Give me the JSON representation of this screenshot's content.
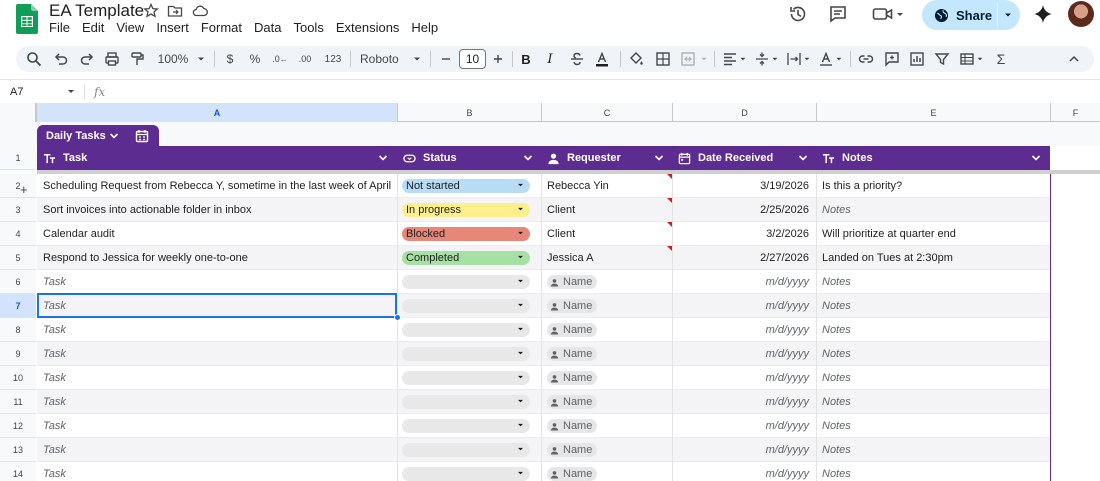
{
  "app": {
    "title": "EA Template",
    "menus": [
      "File",
      "Edit",
      "View",
      "Insert",
      "Format",
      "Data",
      "Tools",
      "Extensions",
      "Help"
    ],
    "share_label": "Share",
    "brand_color": "#5c2c91",
    "accent_color": "#1a73e8"
  },
  "toolbar": {
    "zoom": "100%",
    "currency": "$",
    "percent": "%",
    "number_format": "123",
    "font": "Roboto",
    "font_size": "10"
  },
  "formula_bar": {
    "cell_ref": "A7",
    "fx_symbol": "fx"
  },
  "grid": {
    "columns": [
      "A",
      "B",
      "C",
      "D",
      "E",
      "F"
    ],
    "selected_column": "A",
    "selected_row": "7",
    "row_numbers": [
      "1",
      "2",
      "3",
      "4",
      "5",
      "6",
      "7",
      "8",
      "9",
      "10",
      "11",
      "12",
      "13",
      "14"
    ]
  },
  "table": {
    "name": "Daily Tasks",
    "headers": [
      {
        "label": "Task",
        "icon": "text-type-icon"
      },
      {
        "label": "Status",
        "icon": "dropdown-chip-icon"
      },
      {
        "label": "Requester",
        "icon": "person-icon"
      },
      {
        "label": "Date Received",
        "icon": "calendar-icon"
      },
      {
        "label": "Notes",
        "icon": "text-type-icon"
      }
    ],
    "rows": [
      {
        "task": "Scheduling Request from Rebecca Y, sometime in the last week of April",
        "status": "Not started",
        "status_color": "#b7dcf5",
        "requester": "Rebecca Yin",
        "date": "3/19/2026",
        "notes": "Is this a priority?",
        "notes_placeholder": false
      },
      {
        "task": "Sort invoices into actionable folder in inbox",
        "status": "In progress",
        "status_color": "#fdef8c",
        "requester": "Client",
        "date": "2/25/2026",
        "notes": "Notes",
        "notes_placeholder": true
      },
      {
        "task": "Calendar audit",
        "status": "Blocked",
        "status_color": "#e6877a",
        "requester": "Client",
        "date": "3/2/2026",
        "notes": "Will prioritize at quarter end",
        "notes_placeholder": false
      },
      {
        "task": "Respond to Jessica for weekly one-to-one",
        "status": "Completed",
        "status_color": "#a7e0a4",
        "requester": "Jessica A",
        "date": "2/27/2026",
        "notes": "Landed on Tues at 2:30pm",
        "notes_placeholder": false
      }
    ],
    "placeholders": {
      "task": "Task",
      "requester": "Name",
      "date": "m/d/yyyy",
      "notes": "Notes",
      "empty_chip_color": "#e8e8e8"
    }
  }
}
